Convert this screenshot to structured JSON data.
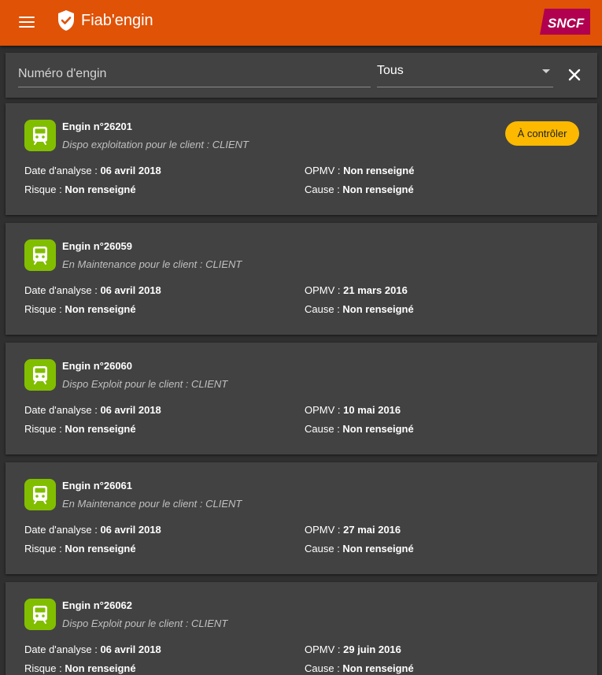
{
  "header": {
    "title": "Fiab'engin",
    "logo_text": "SNCF",
    "colors": {
      "appbar": "#e05206",
      "logo": "#b0004f"
    }
  },
  "filters": {
    "search_placeholder": "Numéro d'engin",
    "search_value": "",
    "status_select_value": "Tous"
  },
  "labels": {
    "date": "Date d'analyse : ",
    "risque": "Risque : ",
    "opmv": "OPMV : ",
    "cause": "Cause : "
  },
  "cards": [
    {
      "title": "Engin n°26201",
      "subtitle": "Dispo exploitation pour le client : CLIENT",
      "date": "06 avril 2018",
      "risque": "Non renseigné",
      "opmv": "Non renseigné",
      "cause": "Non renseigné",
      "badge": "À contrôler"
    },
    {
      "title": "Engin n°26059",
      "subtitle": "En Maintenance pour le client : CLIENT",
      "date": "06 avril 2018",
      "risque": "Non renseigné",
      "opmv": "21 mars 2016",
      "cause": "Non renseigné"
    },
    {
      "title": "Engin n°26060",
      "subtitle": "Dispo Exploit pour le client : CLIENT",
      "date": "06 avril 2018",
      "risque": "Non renseigné",
      "opmv": "10 mai 2016",
      "cause": "Non renseigné"
    },
    {
      "title": "Engin n°26061",
      "subtitle": "En Maintenance pour le client : CLIENT",
      "date": "06 avril 2018",
      "risque": "Non renseigné",
      "opmv": "27 mai 2016",
      "cause": "Non renseigné"
    },
    {
      "title": "Engin n°26062",
      "subtitle": "Dispo Exploit pour le client : CLIENT",
      "date": "06 avril 2018",
      "risque": "Non renseigné",
      "opmv": "29 juin 2016",
      "cause": "Non renseigné"
    }
  ],
  "icons": {
    "menu": "menu-icon",
    "app": "shield-check-icon",
    "clear": "close-icon",
    "train": "train-icon",
    "caret": "caret-down-icon"
  }
}
